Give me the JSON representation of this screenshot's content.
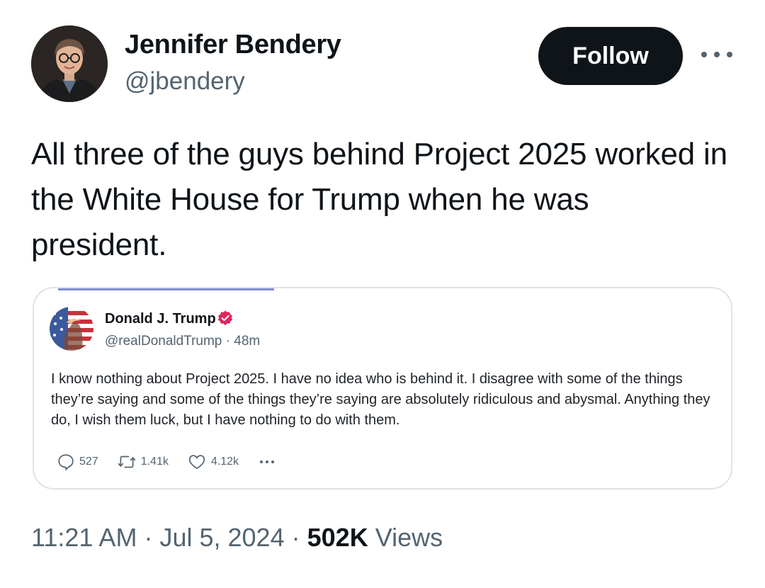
{
  "author": {
    "name": "Jennifer Bendery",
    "handle": "@jbendery"
  },
  "actions": {
    "follow_label": "Follow"
  },
  "tweet": {
    "text": "All three of the guys behind Project 2025 worked in the White House for Trump when he was president."
  },
  "quote": {
    "name": "Donald J. Trump",
    "handle": "@realDonaldTrump",
    "separator": "·",
    "time": "48m",
    "text": "I know nothing about Project 2025. I have no idea who is behind it. I disagree with some of the things they’re saying and some of the things they’re saying are absolutely ridiculous and abysmal. Anything they do, I wish them luck, but I have nothing to do with them.",
    "stats": {
      "replies": "527",
      "reposts": "1.41k",
      "likes": "4.12k"
    },
    "verified_color": "#e0245e"
  },
  "meta": {
    "time": "11:21 AM",
    "date": "Jul 5, 2024",
    "separator": "·",
    "views_count": "502K",
    "views_label": "Views"
  },
  "icons": [
    "more-icon",
    "verified-icon",
    "reply-icon",
    "repost-icon",
    "like-icon"
  ]
}
